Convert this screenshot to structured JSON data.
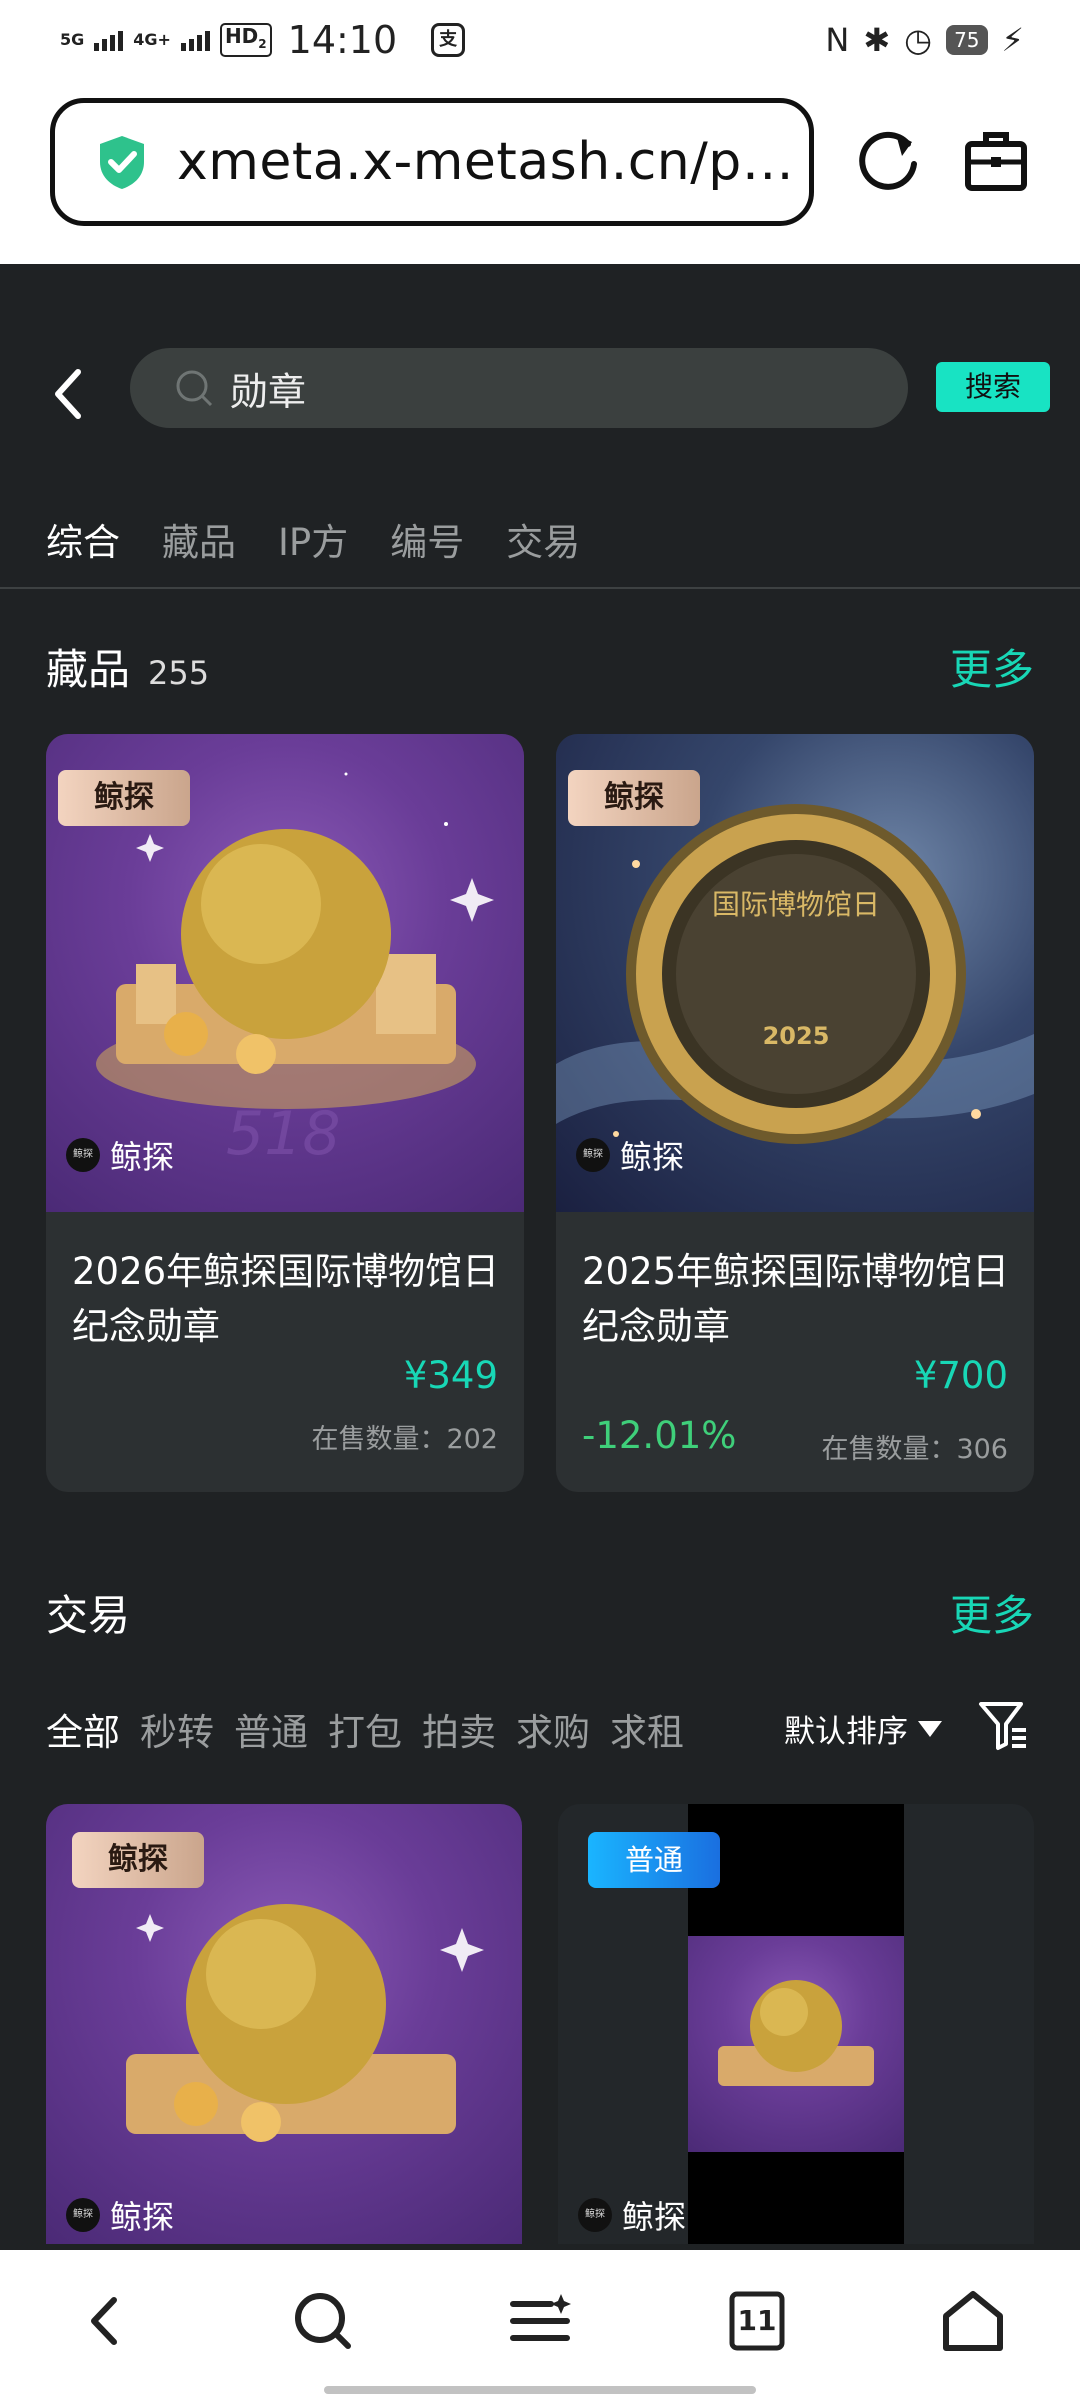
{
  "status_bar": {
    "sig1": "5G",
    "sig2": "4G+",
    "hd": "HD",
    "hd_sub": "2",
    "time": "14:10",
    "app_icon": "支",
    "nfc": "N",
    "bluetooth": "✱",
    "alarm": "◷",
    "battery": "75",
    "charging": "⚡"
  },
  "browser": {
    "url": "xmeta.x-metash.cn/p…",
    "icons": [
      "shield-check-icon",
      "reload-icon",
      "toolbox-icon"
    ]
  },
  "search": {
    "query": "勋章",
    "button": "搜索"
  },
  "tabs": [
    "综合",
    "藏品",
    "IP方",
    "编号",
    "交易"
  ],
  "active_tab": 0,
  "collections": {
    "title": "藏品",
    "count": "255",
    "more": "更多",
    "cards": [
      {
        "badge": "鲸探",
        "issuer": "鲸探",
        "title": "2026年鲸探国际博物馆日纪念勋章",
        "price": "¥349",
        "change": "",
        "stock_label": "在售数量：202"
      },
      {
        "badge": "鲸探",
        "issuer": "鲸探",
        "title": "2025年鲸探国际博物馆日纪念勋章",
        "price": "¥700",
        "change": "-12.01%",
        "stock_label": "在售数量：306"
      }
    ]
  },
  "trades": {
    "title": "交易",
    "more": "更多",
    "filters": [
      "全部",
      "秒转",
      "普通",
      "打包",
      "拍卖",
      "求购",
      "求租"
    ],
    "active_filter": 0,
    "sort_label": "默认排序",
    "cards": [
      {
        "badge": "鲸探",
        "issuer": "鲸探"
      },
      {
        "tag": "普通",
        "issuer": "鲸探"
      }
    ]
  },
  "medal_text": {
    "name": "国际博物馆日",
    "year": "2025",
    "art_518": "518"
  },
  "bottom_nav": {
    "tab_count": "11",
    "icons": [
      "back-icon",
      "search-icon",
      "menu-icon",
      "tabs-icon",
      "home-icon"
    ]
  },
  "colors": {
    "accent": "#18d7b6",
    "background": "#1f2224",
    "card": "#2c3032",
    "negative_change": "#3fcf7a"
  }
}
